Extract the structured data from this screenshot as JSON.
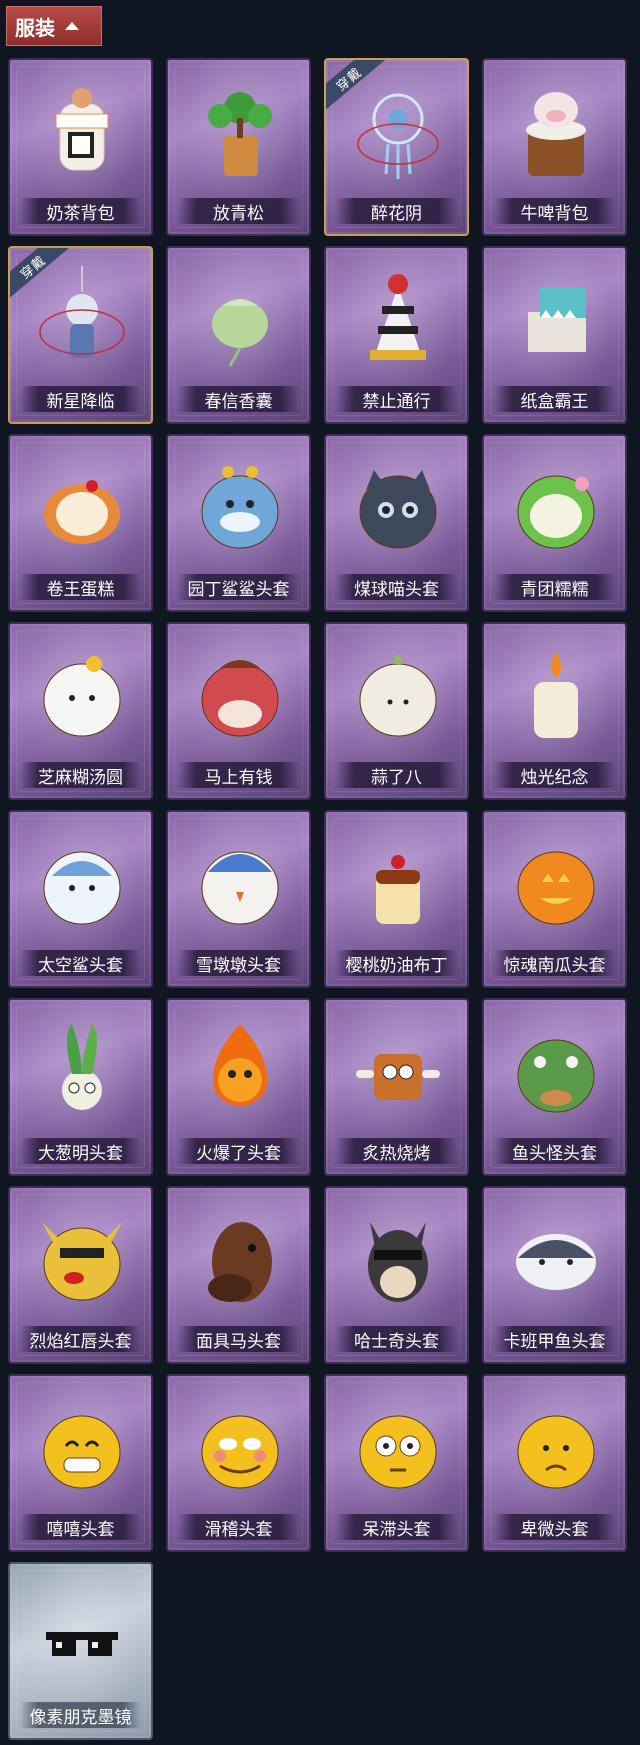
{
  "header": {
    "title": "服装"
  },
  "items": [
    {
      "label": "奶茶背包",
      "icon": "milk-tea-backpack-icon"
    },
    {
      "label": "放青松",
      "icon": "bonsai-pine-icon"
    },
    {
      "label": "醉花阴",
      "icon": "dreamcatcher-icon",
      "badge": "穿戴"
    },
    {
      "label": "牛啤背包",
      "icon": "cow-beer-barrel-icon"
    },
    {
      "label": "新星降临",
      "icon": "keychain-figure-icon",
      "badge": "穿戴"
    },
    {
      "label": "春信香囊",
      "icon": "sachet-pouch-icon"
    },
    {
      "label": "禁止通行",
      "icon": "traffic-cone-icon"
    },
    {
      "label": "纸盒霸王",
      "icon": "box-dinosaur-icon"
    },
    {
      "label": "卷王蛋糕",
      "icon": "roll-cake-icon"
    },
    {
      "label": "园丁鲨鲨头套",
      "icon": "shark-head-icon"
    },
    {
      "label": "煤球喵头套",
      "icon": "cat-head-icon"
    },
    {
      "label": "青团糯糯",
      "icon": "green-rice-ball-icon"
    },
    {
      "label": "芝麻糊汤圆",
      "icon": "rice-dumpling-icon"
    },
    {
      "label": "马上有钱",
      "icon": "horse-plush-icon"
    },
    {
      "label": "蒜了八",
      "icon": "garlic-icon"
    },
    {
      "label": "烛光纪念",
      "icon": "candle-icon"
    },
    {
      "label": "太空鲨头套",
      "icon": "space-shark-icon"
    },
    {
      "label": "雪墩墩头套",
      "icon": "snowman-head-icon"
    },
    {
      "label": "樱桃奶油布丁",
      "icon": "pudding-icon"
    },
    {
      "label": "惊魂南瓜头套",
      "icon": "pumpkin-icon"
    },
    {
      "label": "大葱明头套",
      "icon": "scallion-head-icon"
    },
    {
      "label": "火爆了头套",
      "icon": "fire-head-icon"
    },
    {
      "label": "炙热烧烤",
      "icon": "bbq-meat-icon"
    },
    {
      "label": "鱼头怪头套",
      "icon": "fish-head-icon"
    },
    {
      "label": "烈焰红唇头套",
      "icon": "red-lips-mask-icon"
    },
    {
      "label": "面具马头套",
      "icon": "horse-mask-icon"
    },
    {
      "label": "哈士奇头套",
      "icon": "husky-head-icon"
    },
    {
      "label": "卡班甲鱼头套",
      "icon": "fish-blob-icon"
    },
    {
      "label": "嘻嘻头套",
      "icon": "grin-emoji-icon"
    },
    {
      "label": "滑稽头套",
      "icon": "funny-emoji-icon"
    },
    {
      "label": "呆滞头套",
      "icon": "dazed-emoji-icon"
    },
    {
      "label": "卑微头套",
      "icon": "humble-emoji-icon"
    },
    {
      "label": "像素朋克墨镜",
      "icon": "pixel-sunglasses-icon",
      "rarity": "gray"
    }
  ],
  "colors": {
    "background": "#0f1622",
    "header": "#a33c3a",
    "card_purple": "#8c6aa8",
    "card_gray": "#b0bac8",
    "equipped_border": "#c8a04e"
  }
}
